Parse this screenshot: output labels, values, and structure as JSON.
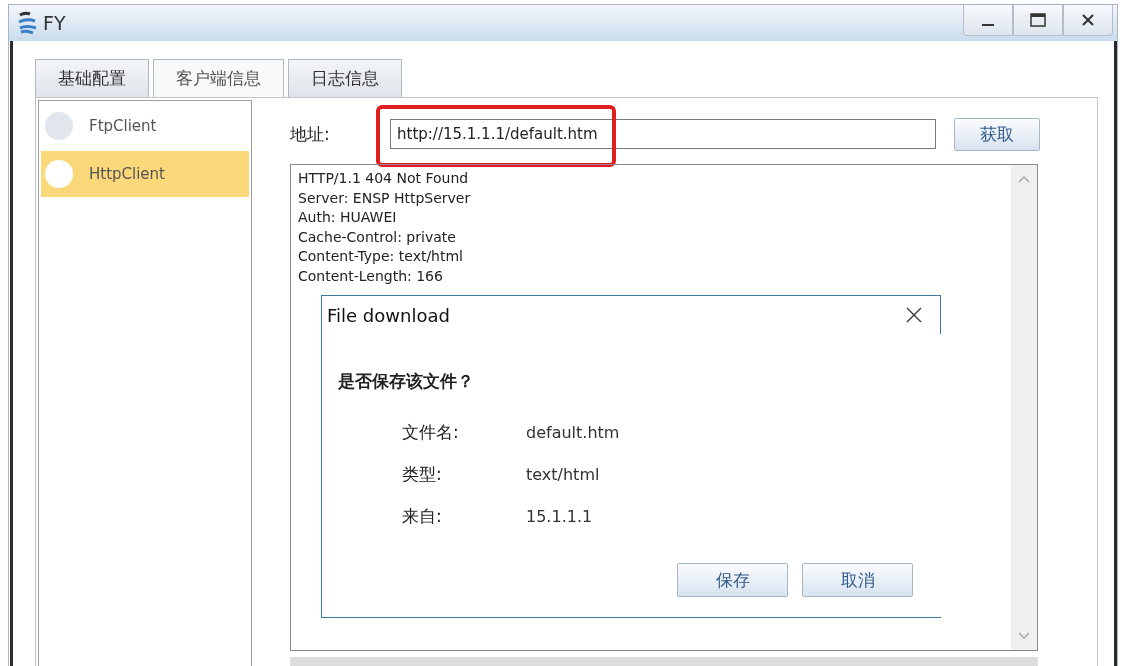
{
  "window": {
    "title": "FY"
  },
  "tabs": [
    {
      "label": "基础配置",
      "selected": false
    },
    {
      "label": "客户端信息",
      "selected": true
    },
    {
      "label": "日志信息",
      "selected": false
    }
  ],
  "clients": [
    {
      "label": "FtpClient",
      "selected": false
    },
    {
      "label": "HttpClient",
      "selected": true
    }
  ],
  "address": {
    "label": "地址:",
    "value": "http://15.1.1.1/default.htm",
    "highlighted": true
  },
  "fetch_button": "获取",
  "response_lines": [
    "HTTP/1.1 404 Not Found",
    "Server: ENSP HttpServer",
    "Auth: HUAWEI",
    "Cache-Control: private",
    "Content-Type: text/html",
    "Content-Length: 166"
  ],
  "dialog": {
    "title": "File download",
    "question": "是否保存该文件？",
    "fields": [
      {
        "label": "文件名:",
        "value": "default.htm"
      },
      {
        "label": "类型:",
        "value": "text/html"
      },
      {
        "label": "来自:",
        "value": "15.1.1.1"
      }
    ],
    "buttons": [
      "保存",
      "取消"
    ]
  }
}
